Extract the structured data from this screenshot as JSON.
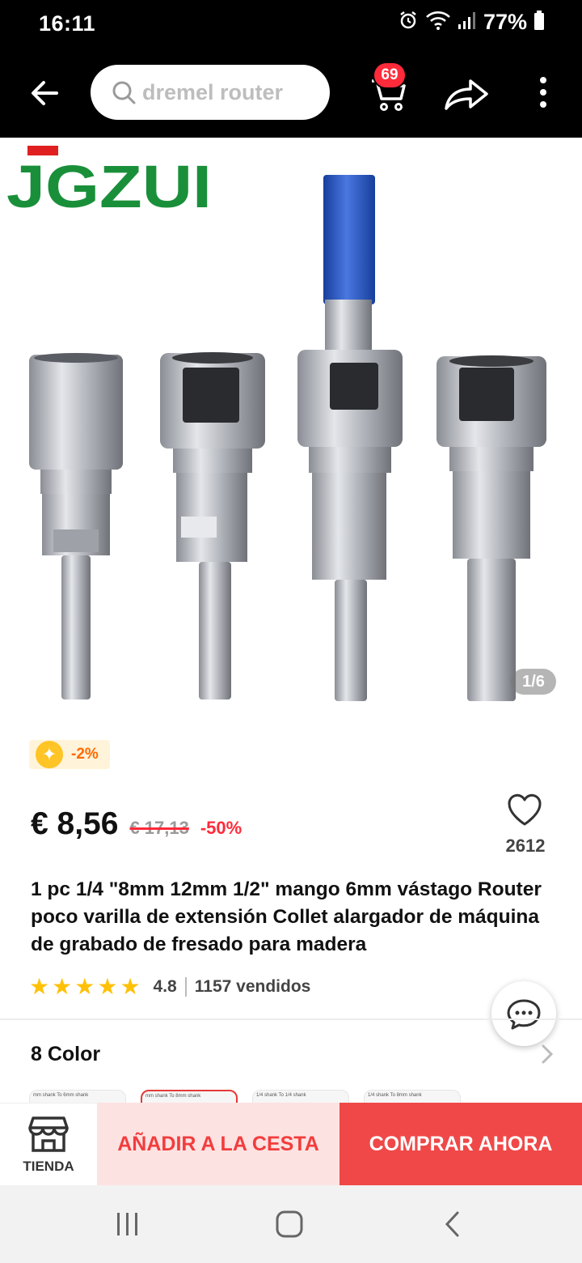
{
  "status_bar": {
    "time": "16:11",
    "battery_percent": "77%",
    "icons": [
      "alarm-icon",
      "wifi-icon",
      "signal-icon",
      "battery-icon"
    ]
  },
  "header": {
    "search_query": "dremel router",
    "cart_count": "69",
    "icons": [
      "back-arrow-icon",
      "search-icon",
      "cart-icon",
      "share-icon",
      "more-vertical-icon"
    ]
  },
  "gallery": {
    "brand": "JGZUI",
    "counter": "1/6"
  },
  "coupon": {
    "text": "-2%"
  },
  "price": {
    "current": "€ 8,56",
    "original": "€ 17,13",
    "discount": "-50%"
  },
  "wishlist": {
    "count": "2612"
  },
  "product": {
    "title": "1 pc 1/4 \"8mm 12mm 1/2\" mango 6mm vástago Router poco varilla de extensión Collet alargador de máquina de grabado de fresado para madera",
    "rating": "4.8",
    "rating_fraction": 0.96,
    "sold": "1157 vendidos"
  },
  "colors": {
    "title": "8 Color",
    "swatches": [
      "mm shank To 6mm shank",
      "mm shank To 8mm shank",
      "1/4 shank To 1/4 shank",
      "1/4 shank To 8mm shank"
    ],
    "selected_index": 1
  },
  "actions": {
    "store_label": "TIENDA",
    "add_to_cart": "AÑADIR A LA CESTA",
    "buy_now": "COMPRAR AHORA"
  },
  "colors_theme": {
    "accent_red": "#f04848",
    "badge_red": "#ff2a3a",
    "star_yellow": "#ffc107",
    "brand_green": "#1a8f3a"
  }
}
